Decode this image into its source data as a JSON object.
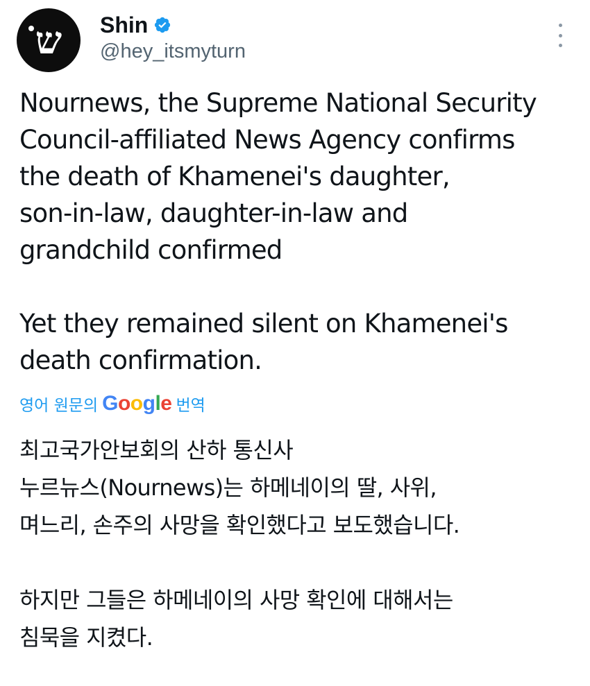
{
  "author": {
    "display_name": "Shin",
    "handle": "@hey_itsmyturn",
    "avatar_glyph": "ש",
    "verified": true,
    "verified_icon": "verified-badge-icon",
    "verified_color": "#1d9bf0"
  },
  "menu": {
    "icon": "more-vertical-icon"
  },
  "tweet": {
    "lines_1": [
      "Nournews, the Supreme National Security",
      "Council-affiliated News Agency confirms",
      "the death of Khamenei's daughter,",
      "son-in-law, daughter-in-law and",
      "grandchild confirmed"
    ],
    "lines_2": [
      "Yet they remained silent on Khamenei's",
      "death confirmation."
    ]
  },
  "translation": {
    "label_before": "영어 원문의",
    "brand": [
      "G",
      "o",
      "o",
      "g",
      "l",
      "e"
    ],
    "label_after": "번역",
    "brand_colors": [
      "#4285f4",
      "#ea4335",
      "#fbbc05",
      "#4285f4",
      "#34a853",
      "#ea4335"
    ],
    "link_color": "#1d9bf0",
    "lines_1": [
      "최고국가안보회의 산하 통신사",
      "누르뉴스(Nournews)는 하메네이의 딸, 사위,",
      "며느리, 손주의 사망을 확인했다고 보도했습니다."
    ],
    "lines_2": [
      "하지만 그들은 하메네이의 사망 확인에 대해서는",
      "침묵을 지켰다."
    ]
  }
}
